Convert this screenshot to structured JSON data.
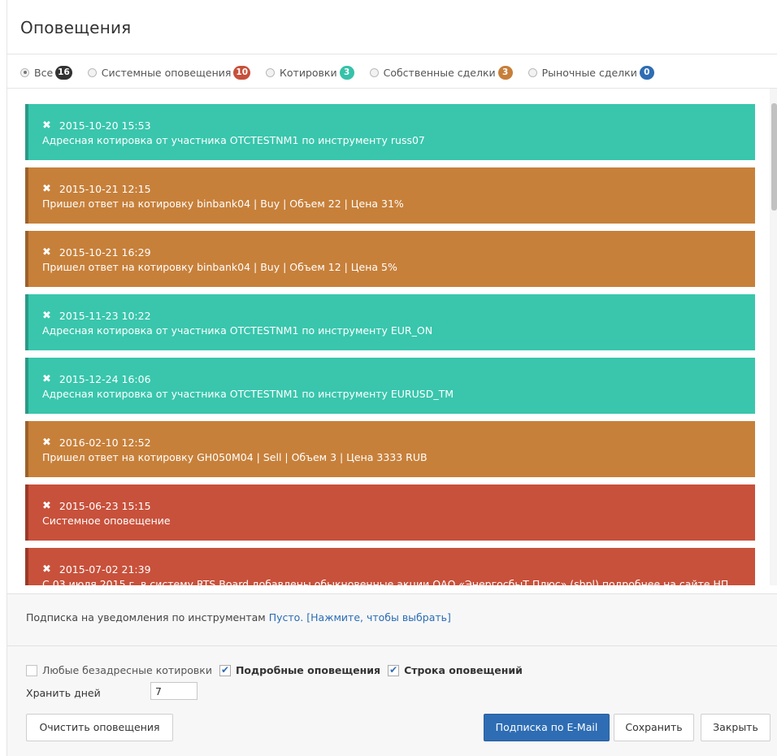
{
  "dialog": {
    "title": "Оповещения"
  },
  "filters": [
    {
      "label": "Все",
      "count": "16",
      "color": "#333333",
      "checked": true
    },
    {
      "label": "Системные оповещения",
      "count": "10",
      "color": "#c7503a",
      "checked": false
    },
    {
      "label": "Котировки",
      "count": "3",
      "color": "#35c2aa",
      "checked": false
    },
    {
      "label": "Собственные сделки",
      "count": "3",
      "color": "#c77f3a",
      "checked": false
    },
    {
      "label": "Рыночные сделки",
      "count": "0",
      "color": "#2e6db4",
      "checked": false
    }
  ],
  "notifications": [
    {
      "time": "2015-10-20 15:53",
      "text": "Адресная котировка от участника OTCTESTNM1 по инструменту russ07",
      "color": "#39c6ad",
      "edge": "#2a9a86"
    },
    {
      "time": "2015-10-21 12:15",
      "text": "Пришел ответ на котировку binbank04 | Buy | Объем 22 | Цена 31%",
      "color": "#c7803a",
      "edge": "#9c622b"
    },
    {
      "time": "2015-10-21 16:29",
      "text": "Пришел ответ на котировку binbank04 | Buy | Объем 12 | Цена 5%",
      "color": "#c7803a",
      "edge": "#9c622b"
    },
    {
      "time": "2015-11-23 10:22",
      "text": "Адресная котировка от участника OTCTESTNM1 по инструменту EUR_ON",
      "color": "#39c6ad",
      "edge": "#2a9a86"
    },
    {
      "time": "2015-12-24 16:06",
      "text": "Адресная котировка от участника OTCTESTNM1 по инструменту EURUSD_TM",
      "color": "#39c6ad",
      "edge": "#2a9a86"
    },
    {
      "time": "2016-02-10 12:52",
      "text": "Пришел ответ на котировку GH050M04 | Sell | Объем 3 | Цена 3333 RUB",
      "color": "#c7803a",
      "edge": "#9c622b"
    },
    {
      "time": "2015-06-23 15:15",
      "text": "Системное оповещение",
      "color": "#c8513b",
      "edge": "#9b3a28"
    },
    {
      "time": "2015-07-02 21:39",
      "text": "С 03 июля 2015 г. в систему RTS Board добавлены обыкновенные акции ОАО «ЭнергосбыТ Плюс» (sbpl) подробнее на сайте НП",
      "color": "#c8513b",
      "edge": "#9b3a28"
    }
  ],
  "subscription": {
    "label": "Подписка на уведомления по инструментам",
    "empty": "Пусто.",
    "choose": "[Нажмите, чтобы выбрать]"
  },
  "options": [
    {
      "label": "Любые безадресные котировки",
      "checked": false,
      "bold": false
    },
    {
      "label": "Подробные оповещения",
      "checked": true,
      "bold": true
    },
    {
      "label": "Строка оповещений",
      "checked": true,
      "bold": true
    }
  ],
  "keep_days": {
    "label": "Хранить дней",
    "value": "7"
  },
  "buttons": {
    "clear": "Очистить оповещения",
    "email": "Подписка по E-Mail",
    "save": "Сохранить",
    "close": "Закрыть"
  }
}
